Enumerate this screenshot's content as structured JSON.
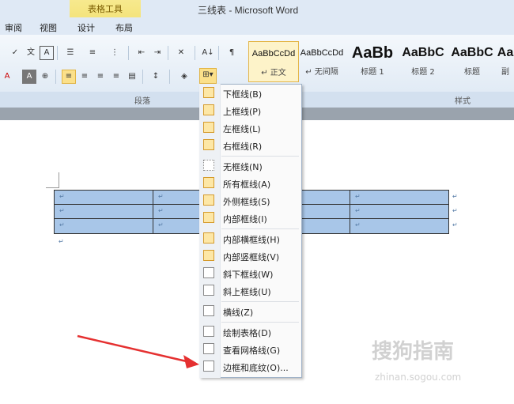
{
  "window": {
    "title": "三线表 - Microsoft Word",
    "contextual_group": "表格工具"
  },
  "tabs": [
    "审阅",
    "视图",
    "设计",
    "布局"
  ],
  "ribbon": {
    "paragraph_group": "段落",
    "styles_group": "样式",
    "styles": [
      {
        "preview": "AaBbCcDd",
        "name": "↵ 正文"
      },
      {
        "preview": "AaBbCcDd",
        "name": "↵ 无间隔"
      },
      {
        "preview": "AaBb",
        "name": "标题 1"
      },
      {
        "preview": "AaBbC",
        "name": "标题 2"
      },
      {
        "preview": "AaBbC",
        "name": "标题"
      },
      {
        "preview": "Aa",
        "name": "副"
      }
    ]
  },
  "menu": {
    "items": [
      "下框线(B)",
      "上框线(P)",
      "左框线(L)",
      "右框线(R)",
      "无框线(N)",
      "所有框线(A)",
      "外侧框线(S)",
      "内部框线(I)",
      "内部横框线(H)",
      "内部竖框线(V)",
      "斜下框线(W)",
      "斜上框线(U)",
      "横线(Z)",
      "绘制表格(D)",
      "查看网格线(G)",
      "边框和底纹(O)..."
    ]
  },
  "document": {
    "cell_mark": "↵"
  },
  "watermark": {
    "text": "搜狗指南",
    "url": "zhinan.sogou.com"
  }
}
